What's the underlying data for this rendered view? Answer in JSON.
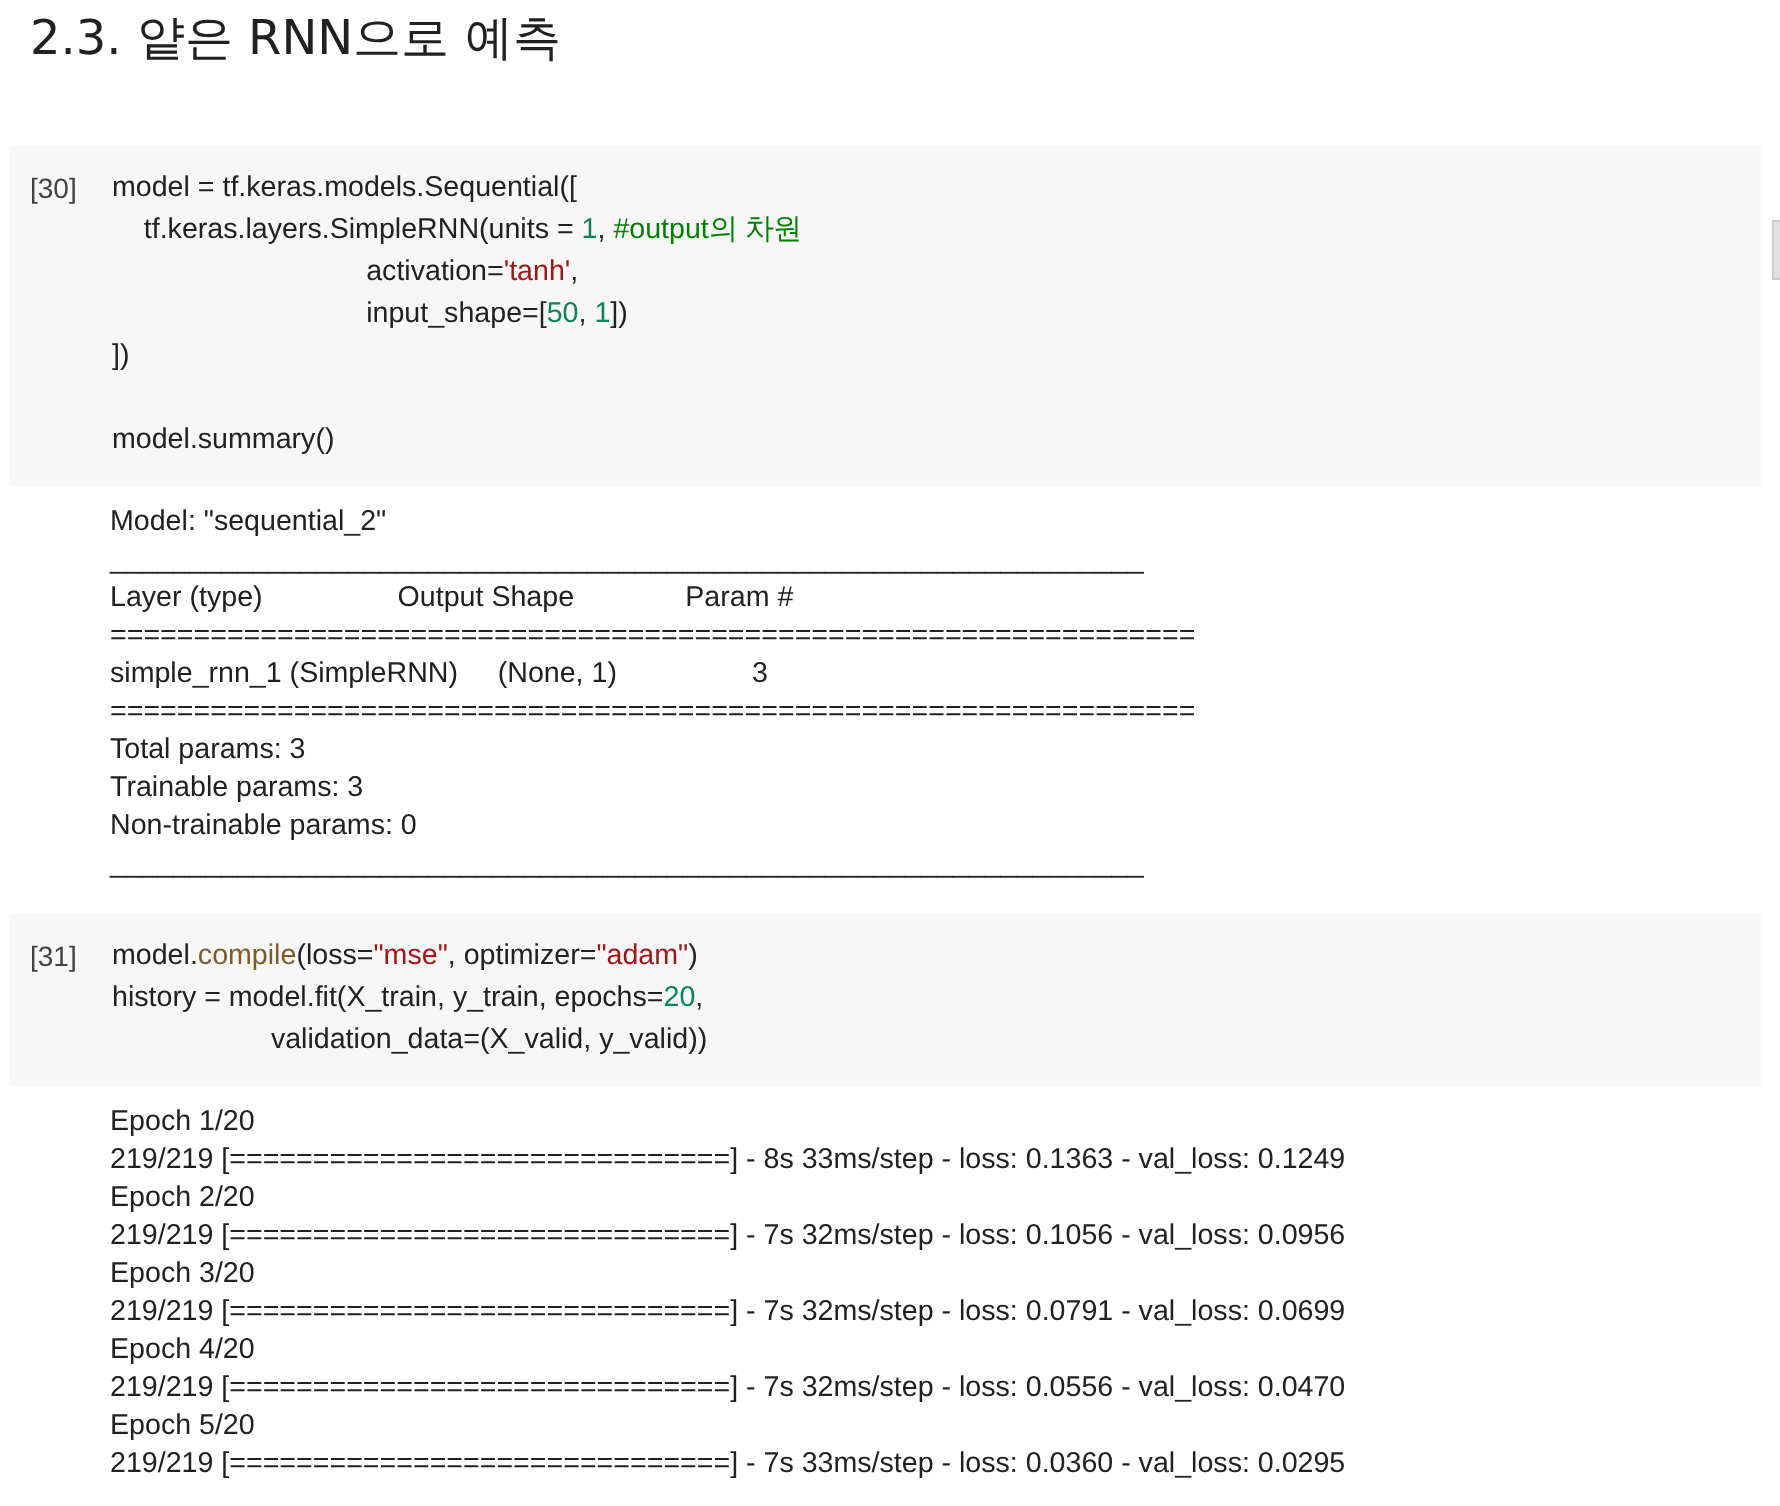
{
  "heading": "2.3. 얕은 RNN으로 예측",
  "cells": [
    {
      "prompt": "[30]",
      "code": [
        [
          {
            "kind": "plain",
            "text": "model = tf.keras.models.Sequential(["
          }
        ],
        [
          {
            "kind": "plain",
            "text": "    tf.keras.layers.SimpleRNN(units = "
          },
          {
            "kind": "number",
            "text": "1"
          },
          {
            "kind": "plain",
            "text": ", "
          },
          {
            "kind": "comment",
            "text": "#output의 차원"
          }
        ],
        [
          {
            "kind": "plain",
            "text": "                                activation="
          },
          {
            "kind": "string",
            "text": "'tanh'"
          },
          {
            "kind": "plain",
            "text": ","
          }
        ],
        [
          {
            "kind": "plain",
            "text": "                                input_shape=["
          },
          {
            "kind": "number",
            "text": "50"
          },
          {
            "kind": "plain",
            "text": ", "
          },
          {
            "kind": "number",
            "text": "1"
          },
          {
            "kind": "plain",
            "text": "])"
          }
        ],
        [
          {
            "kind": "plain",
            "text": "])"
          }
        ],
        {
          "space_before": true,
          "tokens": [
            {
              "kind": "plain",
              "text": "model.summary()"
            }
          ]
        }
      ],
      "output": [
        "Model: \"sequential_2\"",
        "_________________________________________________________________",
        "Layer (type)                 Output Shape              Param #   ",
        "=================================================================",
        "simple_rnn_1 (SimpleRNN)     (None, 1)                 3         ",
        "=================================================================",
        "Total params: 3",
        "Trainable params: 3",
        "Non-trainable params: 0",
        "_________________________________________________________________"
      ]
    },
    {
      "prompt": "[31]",
      "code": [
        [
          {
            "kind": "plain",
            "text": "model."
          },
          {
            "kind": "method",
            "text": "compile"
          },
          {
            "kind": "plain",
            "text": "(loss="
          },
          {
            "kind": "string",
            "text": "\"mse\""
          },
          {
            "kind": "plain",
            "text": ", optimizer="
          },
          {
            "kind": "string",
            "text": "\"adam\""
          },
          {
            "kind": "plain",
            "text": ")"
          }
        ],
        [
          {
            "kind": "plain",
            "text": "history = model.fit(X_train, y_train, epochs="
          },
          {
            "kind": "number",
            "text": "20"
          },
          {
            "kind": "plain",
            "text": ","
          }
        ],
        [
          {
            "kind": "plain",
            "text": "                    validation_data=(X_valid, y_valid))"
          }
        ]
      ],
      "output": [
        "Epoch 1/20",
        "219/219 [==============================] - 8s 33ms/step - loss: 0.1363 - val_loss: 0.1249",
        "Epoch 2/20",
        "219/219 [==============================] - 7s 32ms/step - loss: 0.1056 - val_loss: 0.0956",
        "Epoch 3/20",
        "219/219 [==============================] - 7s 32ms/step - loss: 0.0791 - val_loss: 0.0699",
        "Epoch 4/20",
        "219/219 [==============================] - 7s 32ms/step - loss: 0.0556 - val_loss: 0.0470",
        "Epoch 5/20",
        "219/219 [==============================] - 7s 33ms/step - loss: 0.0360 - val_loss: 0.0295"
      ]
    }
  ]
}
